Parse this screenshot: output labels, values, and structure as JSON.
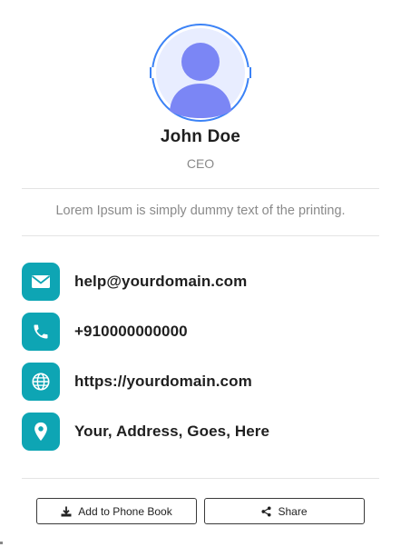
{
  "profile": {
    "name": "John Doe",
    "title": "CEO",
    "bio": "Lorem Ipsum is simply dummy text of the printing.",
    "avatar_icon": "user-avatar-icon"
  },
  "contacts": {
    "email": {
      "text": "help@yourdomain.com",
      "icon": "envelope-icon"
    },
    "phone": {
      "text": "+910000000000",
      "icon": "phone-icon"
    },
    "website": {
      "text": "https://yourdomain.com",
      "icon": "globe-icon"
    },
    "address": {
      "text": "Your, Address, Goes, Here",
      "icon": "map-pin-icon"
    }
  },
  "actions": {
    "add_to_phone_book": "Add to Phone Book",
    "share": "Share"
  },
  "colors": {
    "accent": "#0ea5b4",
    "ring": "#3b82f6",
    "avatar_bg": "#e8edff",
    "avatar_fg": "#7b86f5"
  }
}
